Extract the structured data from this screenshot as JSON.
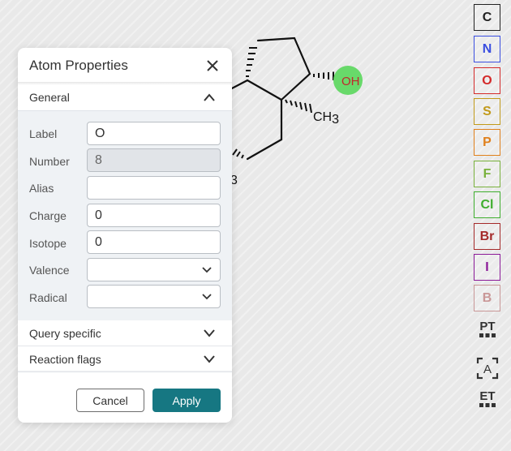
{
  "canvas": {
    "labels": {
      "oh": "OH",
      "ch3": "CH3",
      "ch3_base": "CH",
      "ch3_sub": "3",
      "partial": "3"
    },
    "oh_highlight_color": "#68d96a",
    "oh_text_color": "#c1272d"
  },
  "dialog": {
    "title": "Atom Properties",
    "close_icon": "close-icon",
    "sections": {
      "general": "General",
      "query_specific": "Query specific",
      "reaction_flags": "Reaction flags"
    },
    "fields": {
      "label": {
        "name": "Label",
        "value": "O"
      },
      "number": {
        "name": "Number",
        "value": "8"
      },
      "alias": {
        "name": "Alias",
        "value": ""
      },
      "charge": {
        "name": "Charge",
        "value": "0"
      },
      "isotope": {
        "name": "Isotope",
        "value": "0"
      },
      "valence": {
        "name": "Valence",
        "value": ""
      },
      "radical": {
        "name": "Radical",
        "value": ""
      }
    },
    "buttons": {
      "cancel": "Cancel",
      "apply": "Apply"
    }
  },
  "toolbar": {
    "atoms": [
      {
        "symbol": "C",
        "color": "#222222"
      },
      {
        "symbol": "N",
        "color": "#3a4ee0"
      },
      {
        "symbol": "O",
        "color": "#d42a2a"
      },
      {
        "symbol": "S",
        "color": "#c29a1a"
      },
      {
        "symbol": "P",
        "color": "#e0801c"
      },
      {
        "symbol": "F",
        "color": "#79b13c"
      },
      {
        "symbol": "Cl",
        "color": "#3fae2e"
      },
      {
        "symbol": "Br",
        "color": "#a52a2a"
      },
      {
        "symbol": "I",
        "color": "#8b1a98"
      },
      {
        "symbol": "B",
        "color": "#c99797"
      }
    ],
    "tools": [
      {
        "name": "periodic-table-icon",
        "label": "PT"
      },
      {
        "name": "text-select-icon",
        "label": "A"
      },
      {
        "name": "extended-table-icon",
        "label": "ET"
      }
    ]
  }
}
